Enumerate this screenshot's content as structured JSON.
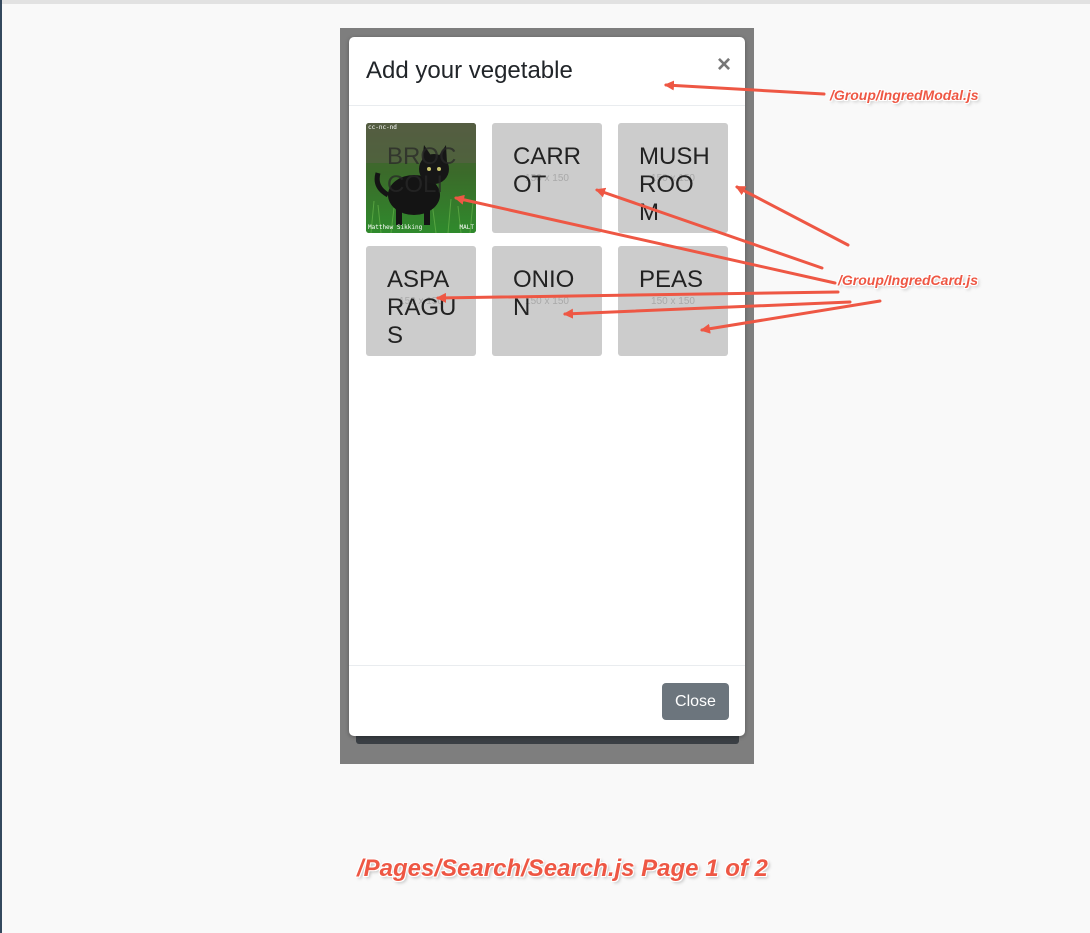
{
  "modal": {
    "title": "Add your vegetable",
    "close_symbol": "×",
    "close_button_label": "Close"
  },
  "cards": [
    {
      "label": "BROCCOLI",
      "placeholder": "",
      "has_photo": true,
      "photo_tags": [
        "cc-nc-nd",
        "Matthew Sikking",
        "MALT"
      ]
    },
    {
      "label": "CARROT",
      "placeholder": "150 x 150",
      "has_photo": false
    },
    {
      "label": "MUSHROOM",
      "placeholder": "150 x 150",
      "has_photo": false
    },
    {
      "label": "ASPARAGUS",
      "placeholder": "150 x 150",
      "has_photo": false
    },
    {
      "label": "ONION",
      "placeholder": "150 x 150",
      "has_photo": false
    },
    {
      "label": "PEAS",
      "placeholder": "150 x 150",
      "has_photo": false
    }
  ],
  "annotations": {
    "modal_file": "/Group/IngredModal.js",
    "card_file": "/Group/IngredCard.js",
    "page_file": "/Pages/Search/Search.js Page 1 of 2"
  },
  "colors": {
    "annotation": "#ee5744",
    "backdrop": "#7e7e7e",
    "card": "#cccccc",
    "close_button": "#6c757d"
  }
}
